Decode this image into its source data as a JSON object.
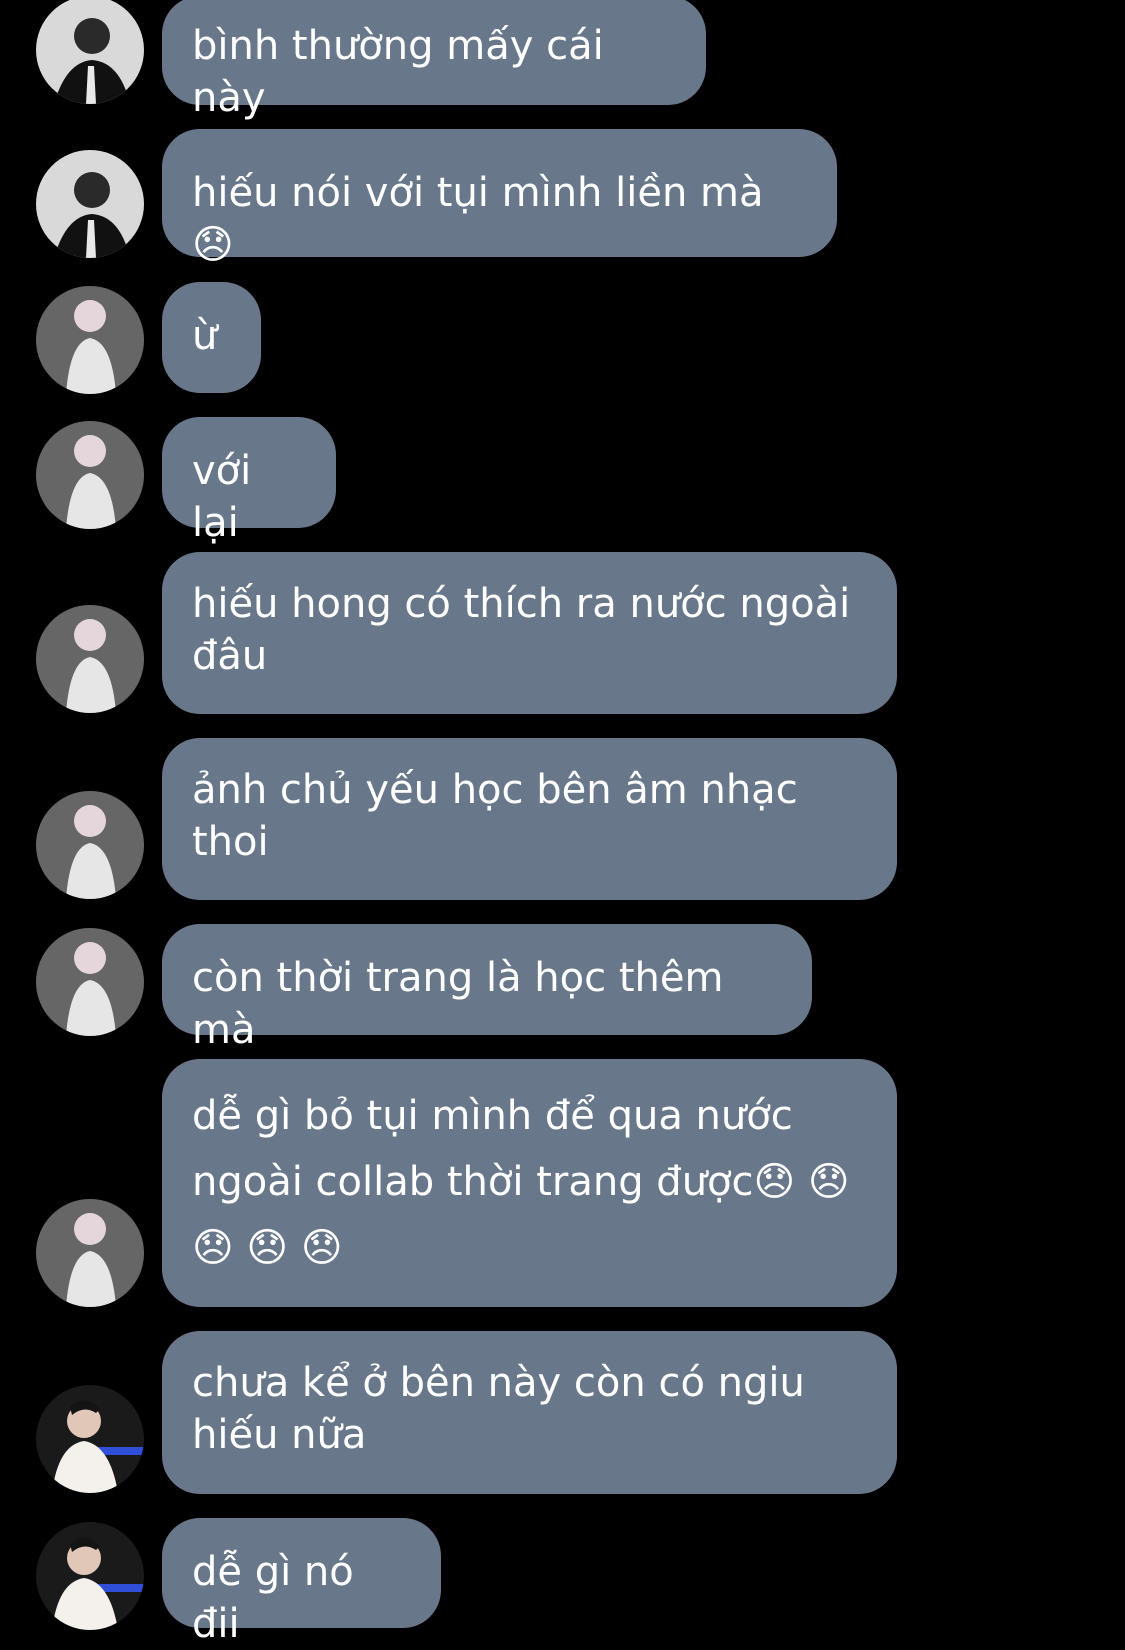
{
  "messages": [
    {
      "text": "bình thường mấy cái này",
      "avatar": "avatar-dark-suit-person"
    },
    {
      "text": "hiếu nói với tụi mình liền mà 😞",
      "avatar": "avatar-dark-suit-person"
    },
    {
      "text": "ừ",
      "avatar": "avatar-white-hair-person"
    },
    {
      "text": "với lại",
      "avatar": "avatar-white-hair-person"
    },
    {
      "text": "hiếu hong có thích ra nước ngoài đâu",
      "avatar": "avatar-white-hair-person"
    },
    {
      "text": "ảnh chủ yếu học bên âm nhạc thoi",
      "avatar": "avatar-white-hair-person"
    },
    {
      "text": "còn thời trang là học thêm mà",
      "avatar": "avatar-white-hair-person"
    },
    {
      "text": "dễ gì bỏ tụi mình để qua nước ngoài collab thời trang được😞 😞 😞 😞 😞",
      "avatar": "avatar-white-hair-person"
    },
    {
      "text": "chưa kể ở bên này còn có ngiu hiếu nữa",
      "avatar": "avatar-white-shirt-person"
    },
    {
      "text": "dễ gì nó đii",
      "avatar": "avatar-white-shirt-person"
    }
  ],
  "colors": {
    "background": "#000000",
    "bubble": "#68788a",
    "text": "#ffffff"
  }
}
